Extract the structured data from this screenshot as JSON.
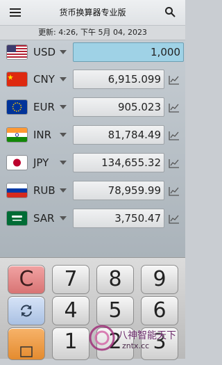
{
  "header": {
    "title": "货币换算器专业版"
  },
  "updated": "更新: 4:26, 下午 5月 04, 2023",
  "base": {
    "code": "USD",
    "amount": "1,000"
  },
  "rows": [
    {
      "code": "CNY",
      "amount": "6,915.099"
    },
    {
      "code": "EUR",
      "amount": "905.023"
    },
    {
      "code": "INR",
      "amount": "81,784.49"
    },
    {
      "code": "JPY",
      "amount": "134,655.32"
    },
    {
      "code": "RUB",
      "amount": "78,959.99"
    },
    {
      "code": "SAR",
      "amount": "3,750.47"
    }
  ],
  "keypad": {
    "clear": "C",
    "k7": "7",
    "k8": "8",
    "k9": "9",
    "k4": "4",
    "k5": "5",
    "k6": "6",
    "k1": "1",
    "k2": "2",
    "k3": "3"
  },
  "watermark": {
    "text": "八神智能天下",
    "url": "zntx.cc"
  },
  "colors": {
    "active_field": "#9fd2e6",
    "clear_key": "#e07d7d",
    "calc_key": "#f0a04a"
  }
}
